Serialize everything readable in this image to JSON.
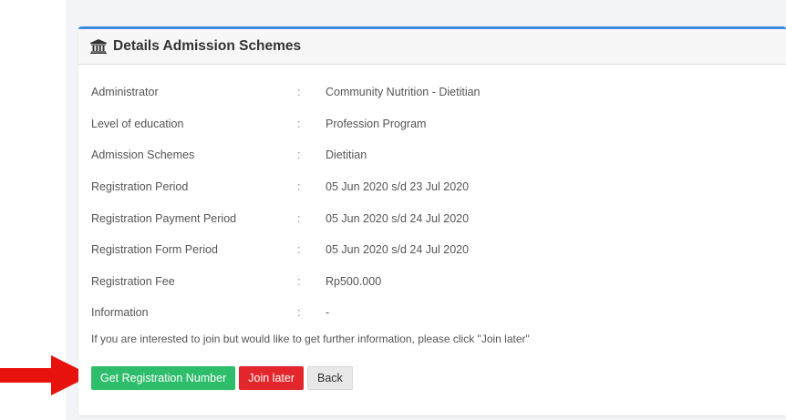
{
  "panel": {
    "title": "Details Admission Schemes",
    "icon": "institution-icon",
    "accent_color": "#3c8dde"
  },
  "details": [
    {
      "label": "Administrator",
      "separator": ":",
      "value": "Community Nutrition - Dietitian"
    },
    {
      "label": "Level of education",
      "separator": ":",
      "value": "Profession Program"
    },
    {
      "label": "Admission Schemes",
      "separator": ":",
      "value": "Dietitian"
    },
    {
      "label": "Registration Period",
      "separator": ":",
      "value": "05 Jun 2020 s/d 23 Jul 2020"
    },
    {
      "label": "Registration Payment Period",
      "separator": ":",
      "value": "05 Jun 2020 s/d 24 Jul 2020"
    },
    {
      "label": "Registration Form Period",
      "separator": ":",
      "value": "05 Jun 2020 s/d 24 Jul 2020"
    },
    {
      "label": "Registration Fee",
      "separator": ":",
      "value": "Rp500.000"
    },
    {
      "label": "Information",
      "separator": ":",
      "value": "-"
    }
  ],
  "note": "If you are interested to join but would like to get further information, please click \"Join later\"",
  "buttons": {
    "get_registration": {
      "label": "Get Registration Number",
      "color": "#2ebd6b"
    },
    "join_later": {
      "label": "Join later",
      "color": "#e3262b"
    },
    "back": {
      "label": "Back"
    }
  },
  "annotation": {
    "icon": "red-arrow-icon",
    "color": "#e8120c"
  }
}
